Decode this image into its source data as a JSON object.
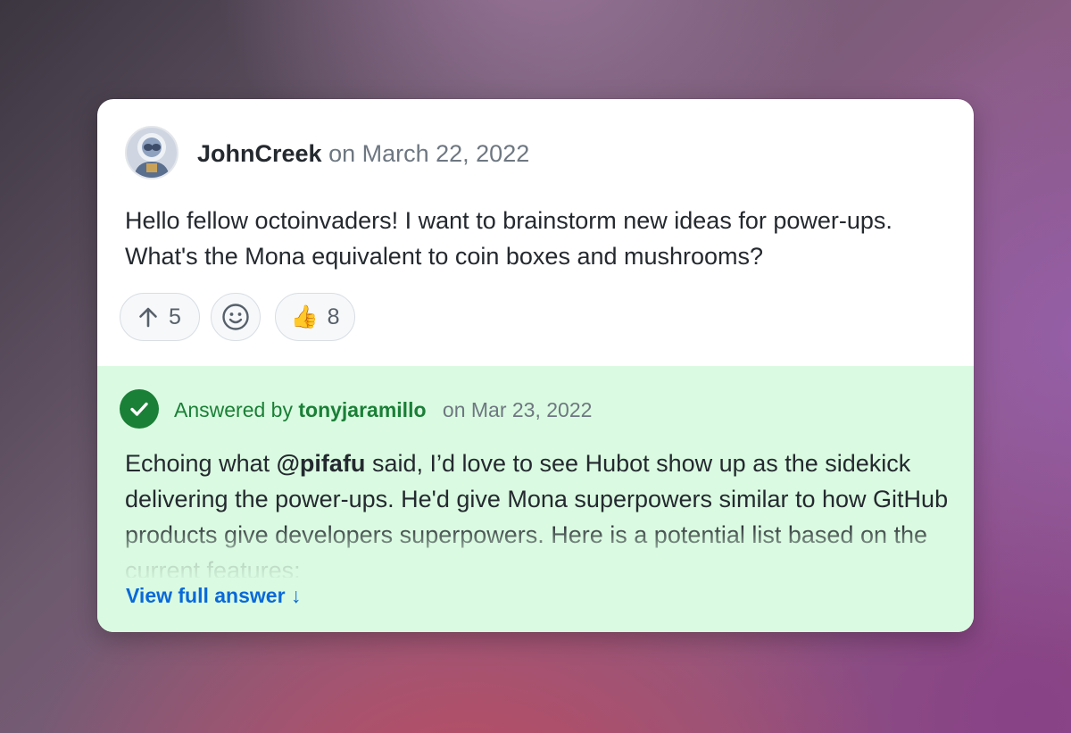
{
  "post": {
    "author": "JohnCreek",
    "date": "on March 22, 2022",
    "body": "Hello fellow octoinvaders! I want to brainstorm new ideas for power-ups. What's the Mona equivalent to coin boxes and mushrooms?",
    "reactions": {
      "upvote_count": "5",
      "thumbs_up_emoji": "👍",
      "thumbs_up_count": "8"
    }
  },
  "answer": {
    "answered_by_label": "Answered by",
    "answerer": "tonyjaramillo",
    "date": "on Mar 23, 2022",
    "body_before": "Echoing what ",
    "mention": "@pifafu",
    "body_after": " said, I’d love to see Hubot show up as the sidekick delivering the power-ups. He'd give Mona superpowers similar to how GitHub products give developers superpowers. Here is a potential list based on the current features:",
    "view_full_label": "View full answer ↓"
  },
  "colors": {
    "answered_green": "#1a7f37",
    "answer_background": "#dafbe1",
    "link_blue": "#0969da",
    "text": "#24292f",
    "muted": "#6e7781"
  },
  "icons": [
    "arrow-up-icon",
    "smiley-icon",
    "check-circle-icon",
    "avatar-image"
  ]
}
